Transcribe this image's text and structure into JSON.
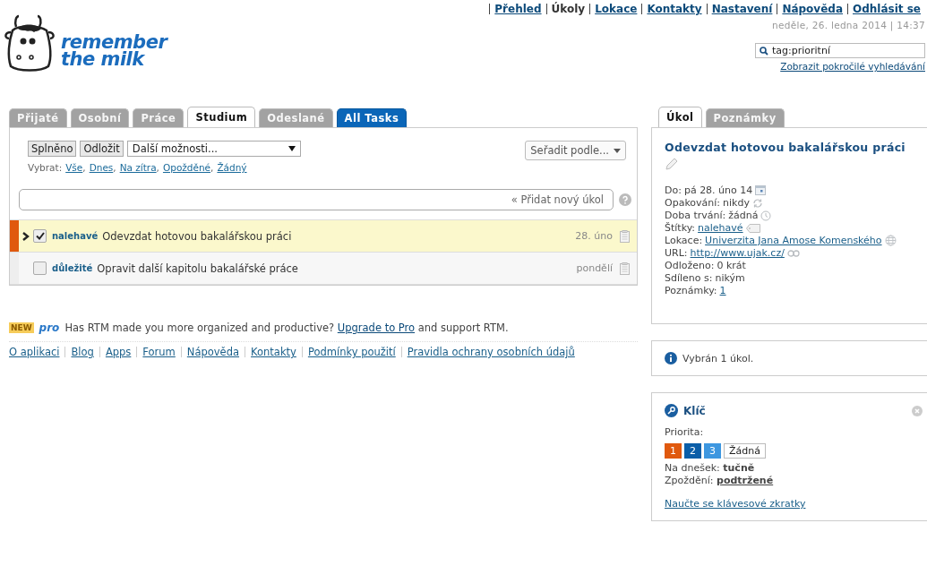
{
  "logo": {
    "line_1": "remember",
    "line_2": "the milk"
  },
  "nav": [
    {
      "label": "Přehled",
      "selected": false
    },
    {
      "label": "Úkoly",
      "selected": true
    },
    {
      "label": "Lokace",
      "selected": false
    },
    {
      "label": "Kontakty",
      "selected": false
    },
    {
      "label": "Nastavení",
      "selected": false
    },
    {
      "label": "Nápověda",
      "selected": false
    },
    {
      "label": "Odhlásit se",
      "selected": false
    }
  ],
  "datetime": "neděle, 26. ledna 2014 | 14:37",
  "search": {
    "value": "tag:prioritní",
    "advanced_link": "Zobrazit pokročilé vyhledávání"
  },
  "tabs": [
    {
      "label": "Přijaté",
      "kind": "list",
      "selected": false
    },
    {
      "label": "Osobní",
      "kind": "list",
      "selected": false
    },
    {
      "label": "Práce",
      "kind": "list",
      "selected": false
    },
    {
      "label": "Studium",
      "kind": "list",
      "selected": true
    },
    {
      "label": "Odeslané",
      "kind": "list",
      "selected": false
    },
    {
      "label": "All Tasks",
      "kind": "smart",
      "selected": false
    }
  ],
  "toolbar": {
    "buttons": [
      "Splněno",
      "Odložit"
    ],
    "more_select": "Další možnosti...",
    "sort": "Seřadit podle...",
    "select_label": "Vybrat:",
    "select_links": [
      {
        "label": "Vše",
        "separator": ","
      },
      {
        "label": "Dnes",
        "separator": ","
      },
      {
        "label": "Na zítra",
        "separator": ","
      },
      {
        "label": "Opožděné",
        "separator": ","
      },
      {
        "label": "Žádný"
      }
    ]
  },
  "add_task": {
    "placeholder": "« Přidat nový úkol"
  },
  "tasks": [
    {
      "color": "#e0590e",
      "selected": true,
      "checked": true,
      "tag": "nalehavé",
      "title": "Odevzdat hotovou bakalářskou práci",
      "due": "28. úno"
    },
    {
      "color": "#eeeeee",
      "selected": false,
      "checked": false,
      "tag": "důležité",
      "title": "Opravit další kapitolu bakalářské práce",
      "due": "pondělí"
    }
  ],
  "promo": {
    "badge": "NEW",
    "pro": "pro",
    "text_before": "Has RTM made you more organized and productive?",
    "link": "Upgrade to Pro",
    "text_after": "and support RTM."
  },
  "footer_links": [
    "O aplikaci",
    "Blog",
    "Apps",
    "Forum",
    "Nápověda",
    "Kontakty",
    "Podmínky použití",
    "Pravidla ochrany osobních údajů"
  ],
  "detail_tabs": [
    {
      "label": "Úkol",
      "selected": true
    },
    {
      "label": "Poznámky",
      "selected": false
    }
  ],
  "detail": {
    "title": "Odevzdat hotovou bakalářskou práci",
    "fields": [
      {
        "label": "Do:",
        "value": "pá 28. úno 14",
        "link": false,
        "kind": "calendar"
      },
      {
        "label": "Opakování:",
        "value": "nikdy",
        "link": false,
        "kind": "repeat"
      },
      {
        "label": "Doba trvání:",
        "value": "žádná",
        "link": false,
        "kind": "clock"
      },
      {
        "label": "Štítky:",
        "value": "nalehavé",
        "link": true,
        "kind": "tag"
      },
      {
        "label": "Lokace:",
        "value": "Univerzita Jana Amose Komenského",
        "link": true,
        "kind": "globe"
      },
      {
        "label": "URL:",
        "value": "http://www.ujak.cz/",
        "link": true,
        "kind": "url"
      },
      {
        "label": "Odloženo:",
        "value": "0 krát",
        "link": false,
        "kind": "plain"
      },
      {
        "label": "Sdíleno s:",
        "value": "nikým",
        "link": false,
        "kind": "plain"
      },
      {
        "label": "Poznámky:",
        "value": "1",
        "link": true,
        "kind": "plain"
      }
    ]
  },
  "info": "Vybrán 1 úkol.",
  "legend": {
    "title": "Klíč",
    "priority_label": "Priorita:",
    "priorities": [
      {
        "label": "1",
        "color": "#e0590e"
      },
      {
        "label": "2",
        "color": "#0b5ea8"
      },
      {
        "label": "3",
        "color": "#3d97e0"
      },
      {
        "label": "Žádná",
        "color": "#ffffff"
      }
    ],
    "styles": [
      {
        "text": "Na dnešek: **tučně**",
        "underline": false
      },
      {
        "text": "Zpoždění: **podtržené**",
        "underline": true
      }
    ],
    "shortcuts_link": "Naučte se klávesové zkratky"
  }
}
